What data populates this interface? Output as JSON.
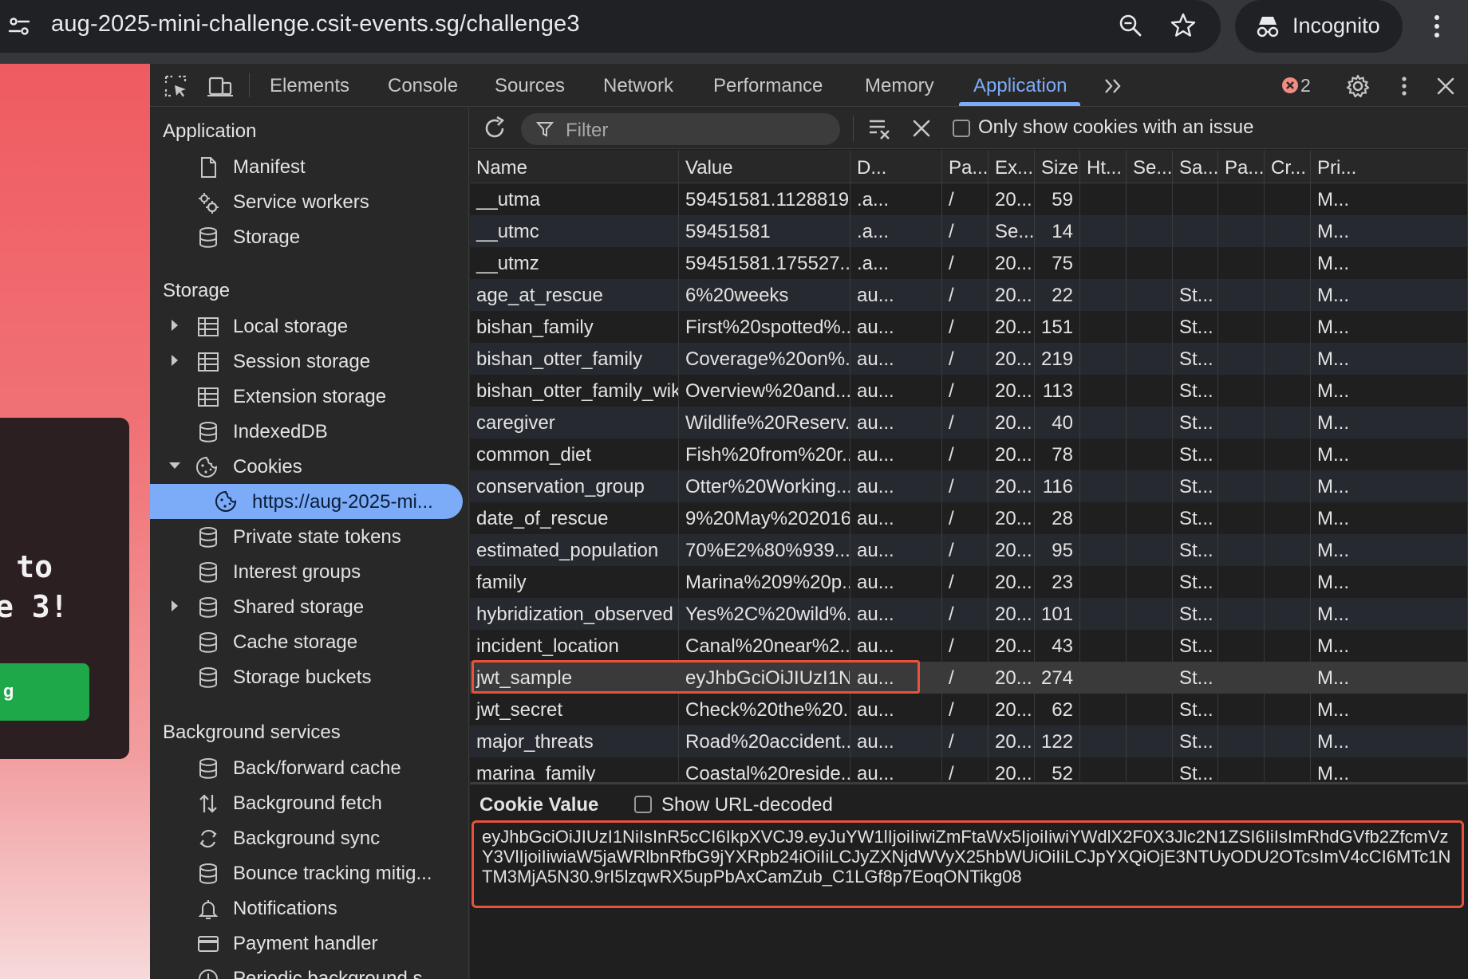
{
  "browser": {
    "url": "aug-2025-mini-challenge.csit-events.sg/challenge3",
    "profile_label": "Incognito",
    "icons": [
      "site-info-icon",
      "zoom-icon",
      "star-icon",
      "incognito-icon",
      "kebab-menu-icon"
    ]
  },
  "page": {
    "heading_fragment": "to\ne 3!",
    "button_fragment": "g"
  },
  "devtools": {
    "tabs": [
      "Elements",
      "Console",
      "Sources",
      "Network",
      "Performance",
      "Memory",
      "Application"
    ],
    "active_tab": "Application",
    "error_count": "2",
    "sidebar": {
      "application_title": "Application",
      "application_items": [
        "Manifest",
        "Service workers",
        "Storage"
      ],
      "storage_title": "Storage",
      "storage_items": [
        "Local storage",
        "Session storage",
        "Extension storage",
        "IndexedDB",
        "Cookies"
      ],
      "cookie_origin": "https://aug-2025-mi...",
      "storage_items_2": [
        "Private state tokens",
        "Interest groups",
        "Shared storage",
        "Cache storage",
        "Storage buckets"
      ],
      "background_title": "Background services",
      "background_items": [
        "Back/forward cache",
        "Background fetch",
        "Background sync",
        "Bounce tracking mitig...",
        "Notifications",
        "Payment handler",
        "Periodic background s..."
      ]
    },
    "filter": {
      "placeholder": "Filter",
      "only_issue_label": "Only show cookies with an issue"
    },
    "table": {
      "headers": [
        "Name",
        "Value",
        "D...",
        "Pa...",
        "Ex...",
        "Size",
        "Ht...",
        "Se...",
        "Sa...",
        "Pa...",
        "Cr...",
        "Pri..."
      ],
      "rows": [
        [
          "__utma",
          "59451581.1128819...",
          ".a...",
          "/",
          "20...",
          "59",
          "",
          "",
          "",
          "",
          "",
          "M..."
        ],
        [
          "__utmc",
          "59451581",
          ".a...",
          "/",
          "Se...",
          "14",
          "",
          "",
          "",
          "",
          "",
          "M..."
        ],
        [
          "__utmz",
          "59451581.175527...",
          ".a...",
          "/",
          "20...",
          "75",
          "",
          "",
          "",
          "",
          "",
          "M..."
        ],
        [
          "age_at_rescue",
          "6%20weeks",
          "au...",
          "/",
          "20...",
          "22",
          "",
          "",
          "St...",
          "",
          "",
          "M..."
        ],
        [
          "bishan_family",
          "First%20spotted%...",
          "au...",
          "/",
          "20...",
          "151",
          "",
          "",
          "St...",
          "",
          "",
          "M..."
        ],
        [
          "bishan_otter_family",
          "Coverage%20on%...",
          "au...",
          "/",
          "20...",
          "219",
          "",
          "",
          "St...",
          "",
          "",
          "M..."
        ],
        [
          "bishan_otter_family_wiki",
          "Overview%20and...",
          "au...",
          "/",
          "20...",
          "113",
          "",
          "",
          "St...",
          "",
          "",
          "M..."
        ],
        [
          "caregiver",
          "Wildlife%20Reserv...",
          "au...",
          "/",
          "20...",
          "40",
          "",
          "",
          "St...",
          "",
          "",
          "M..."
        ],
        [
          "common_diet",
          "Fish%20from%20r...",
          "au...",
          "/",
          "20...",
          "78",
          "",
          "",
          "St...",
          "",
          "",
          "M..."
        ],
        [
          "conservation_group",
          "Otter%20Working...",
          "au...",
          "/",
          "20...",
          "116",
          "",
          "",
          "St...",
          "",
          "",
          "M..."
        ],
        [
          "date_of_rescue",
          "9%20May%202016",
          "au...",
          "/",
          "20...",
          "28",
          "",
          "",
          "St...",
          "",
          "",
          "M..."
        ],
        [
          "estimated_population",
          "70%E2%80%939...",
          "au...",
          "/",
          "20...",
          "95",
          "",
          "",
          "St...",
          "",
          "",
          "M..."
        ],
        [
          "family",
          "Marina%209%20p...",
          "au...",
          "/",
          "20...",
          "23",
          "",
          "",
          "St...",
          "",
          "",
          "M..."
        ],
        [
          "hybridization_observed",
          "Yes%2C%20wild%...",
          "au...",
          "/",
          "20...",
          "101",
          "",
          "",
          "St...",
          "",
          "",
          "M..."
        ],
        [
          "incident_location",
          "Canal%20near%2...",
          "au...",
          "/",
          "20...",
          "43",
          "",
          "",
          "St...",
          "",
          "",
          "M..."
        ],
        [
          "jwt_sample",
          "eyJhbGciOiJIUzI1N...",
          "au...",
          "/",
          "20...",
          "274",
          "",
          "",
          "St...",
          "",
          "",
          "M..."
        ],
        [
          "jwt_secret",
          "Check%20the%20...",
          "au...",
          "/",
          "20...",
          "62",
          "",
          "",
          "St...",
          "",
          "",
          "M..."
        ],
        [
          "major_threats",
          "Road%20accident...",
          "au...",
          "/",
          "20...",
          "122",
          "",
          "",
          "St...",
          "",
          "",
          "M..."
        ],
        [
          "marina_family",
          "Coastal%20reside...",
          "au...",
          "/",
          "20...",
          "52",
          "",
          "",
          "St...",
          "",
          "",
          "M..."
        ]
      ],
      "selected_row": "jwt_sample"
    },
    "cookie_value": {
      "title": "Cookie Value",
      "show_decoded_label": "Show URL-decoded",
      "value": "eyJhbGciOiJIUzI1NiIsInR5cCI6IkpXVCJ9.eyJuYW1lIjoiIiwiZmFtaWx5IjoiIiwiYWdlX2F0X3Jlc2N1ZSI6IiIsImRhdGVfb2ZfcmVzY3VlIjoiIiwiaW5jaWRlbnRfbG9jYXRpb24iOiIiLCJyZXNjdWVyX25hbWUiOiIiLCJpYXQiOjE3NTUyODU2OTcsImV4cCI6MTc1NTM3MjA5N30.9rI5lzqwRX5upPbAxCamZub_C1LGf8p7EoqONTikg08"
    },
    "colors": {
      "accent": "#7cacf8",
      "highlight": "#e8523a",
      "error": "#f28b82"
    }
  }
}
